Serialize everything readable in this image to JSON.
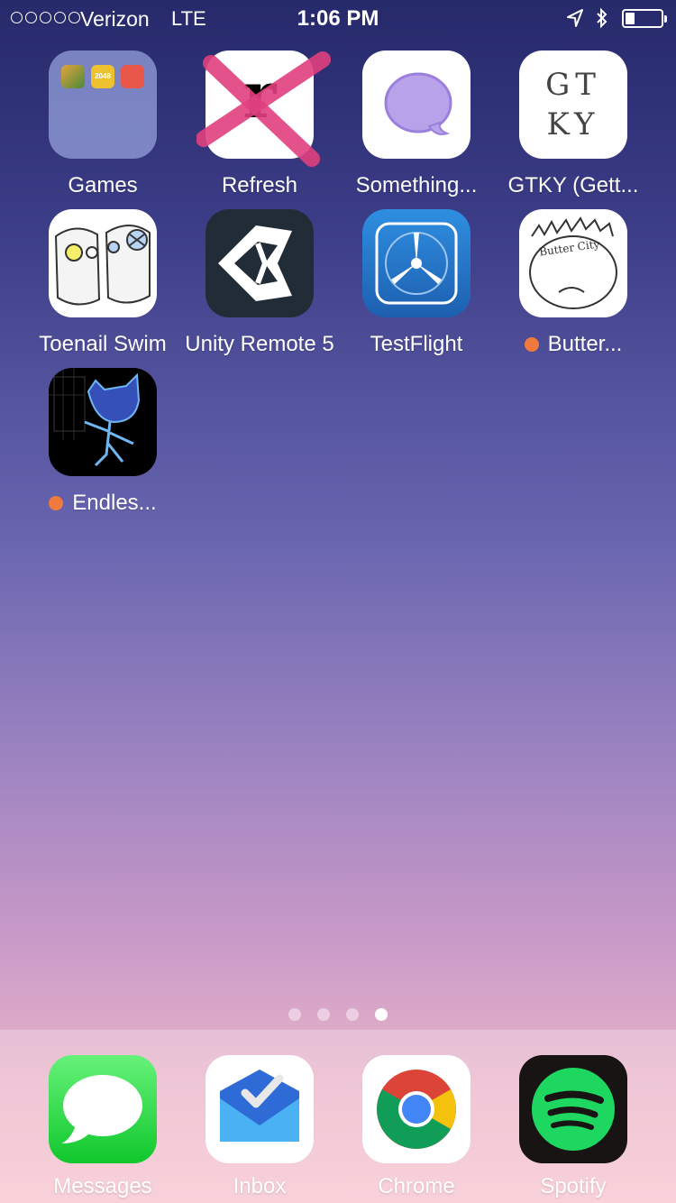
{
  "status_bar": {
    "carrier": "Verizon",
    "network": "LTE",
    "time": "1:06 PM",
    "signal_bars": 0,
    "battery_level": 0.25
  },
  "apps": [
    {
      "name": "games",
      "label": "Games"
    },
    {
      "name": "refresh",
      "label": "Refresh"
    },
    {
      "name": "something",
      "label": "Something..."
    },
    {
      "name": "gtky",
      "label": "GTKY (Gett..."
    },
    {
      "name": "toenail-swim",
      "label": "Toenail Swim"
    },
    {
      "name": "unity-remote",
      "label": "Unity Remote 5"
    },
    {
      "name": "testflight",
      "label": "TestFlight"
    },
    {
      "name": "butter",
      "label": "Butter..."
    },
    {
      "name": "endless",
      "label": "Endles..."
    }
  ],
  "folder_mini_icons": {
    "game_2048": "2048"
  },
  "icon_text": {
    "refresh_glyph": "r",
    "gtky_art": "GT KY",
    "butter_city": "Butter City"
  },
  "page_indicator": {
    "count": 4,
    "current": 4
  },
  "dock": [
    {
      "name": "messages",
      "label": "Messages"
    },
    {
      "name": "inbox",
      "label": "Inbox"
    },
    {
      "name": "chrome",
      "label": "Chrome"
    },
    {
      "name": "spotify",
      "label": "Spotify"
    }
  ],
  "colors": {
    "notification_dot": "#f07a3e",
    "messages_green": "#2fd24a",
    "spotify_green": "#1ed760",
    "testflight_blue": "#1f73c8"
  }
}
